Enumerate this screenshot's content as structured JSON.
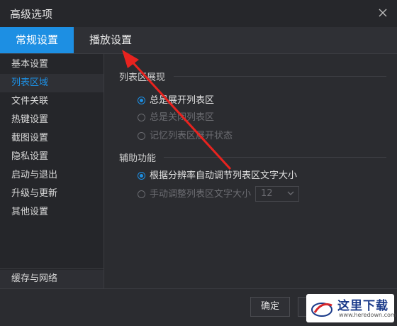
{
  "window": {
    "title": "高级选项"
  },
  "tabs": [
    {
      "label": "常规设置",
      "active": true
    },
    {
      "label": "播放设置",
      "active": false
    }
  ],
  "sidebar": {
    "items": [
      {
        "label": "基本设置",
        "active": false
      },
      {
        "label": "列表区域",
        "active": true
      },
      {
        "label": "文件关联",
        "active": false
      },
      {
        "label": "热键设置",
        "active": false
      },
      {
        "label": "截图设置",
        "active": false
      },
      {
        "label": "隐私设置",
        "active": false
      },
      {
        "label": "启动与退出",
        "active": false
      },
      {
        "label": "升级与更新",
        "active": false
      },
      {
        "label": "其他设置",
        "active": false
      }
    ],
    "bottom_item": "缓存与网络"
  },
  "sections": {
    "list_display": {
      "title": "列表区展现",
      "options": [
        {
          "label": "总是展开列表区",
          "selected": true,
          "enabled": true
        },
        {
          "label": "总是关闭列表区",
          "selected": false,
          "enabled": false
        },
        {
          "label": "记忆列表区展开状态",
          "selected": false,
          "enabled": false
        }
      ]
    },
    "assist": {
      "title": "辅助功能",
      "options": [
        {
          "label": "根据分辨率自动调节列表区文字大小",
          "selected": true,
          "enabled": true
        },
        {
          "label": "手动调整列表区文字大小",
          "selected": false,
          "enabled": false
        }
      ],
      "font_size_select": {
        "value": "12"
      }
    }
  },
  "footer": {
    "ok_label": "确定"
  },
  "watermark": {
    "text": "这里下载",
    "url": "www.heredown.com"
  },
  "colors": {
    "accent": "#1d8fe3",
    "annotation_arrow": "#e8231f"
  },
  "icons": {
    "close": "close-icon",
    "chevron": "chevron-down-icon"
  }
}
